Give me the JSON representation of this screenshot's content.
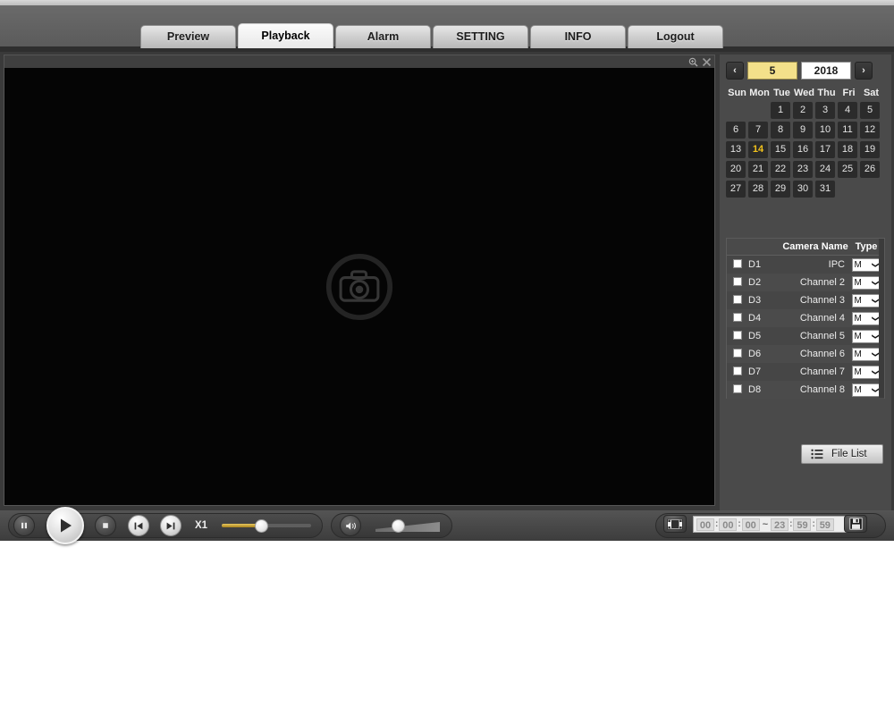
{
  "nav": {
    "tabs": [
      {
        "label": "Preview",
        "active": false
      },
      {
        "label": "Playback",
        "active": true
      },
      {
        "label": "Alarm",
        "active": false
      },
      {
        "label": "SETTING",
        "active": false
      },
      {
        "label": "INFO",
        "active": false
      },
      {
        "label": "Logout",
        "active": false
      }
    ]
  },
  "video": {
    "zoom_icon": "zoom-in-icon",
    "close_icon": "close-icon",
    "placeholder_icon": "camera-icon",
    "background_color": "#050505"
  },
  "calendar": {
    "prev_label": "‹",
    "next_label": "›",
    "month": "5",
    "year": "2018",
    "month_bg": "#f3e08a",
    "selected_day": "14",
    "selected_color": "#f2c21c",
    "weekdays": [
      "Sun",
      "Mon",
      "Tue",
      "Wed",
      "Thu",
      "Fri",
      "Sat"
    ],
    "weeks": [
      [
        "",
        "",
        "1",
        "2",
        "3",
        "4",
        "5"
      ],
      [
        "6",
        "7",
        "8",
        "9",
        "10",
        "11",
        "12"
      ],
      [
        "13",
        "14",
        "15",
        "16",
        "17",
        "18",
        "19"
      ],
      [
        "20",
        "21",
        "22",
        "23",
        "24",
        "25",
        "26"
      ],
      [
        "27",
        "28",
        "29",
        "30",
        "31",
        "",
        ""
      ]
    ]
  },
  "cameras": {
    "headers": {
      "checkbox": "",
      "id": "",
      "name": "Camera Name",
      "type": "Type"
    },
    "type_value": "M",
    "rows": [
      {
        "id": "D1",
        "name": "IPC",
        "type": "M",
        "checked": false
      },
      {
        "id": "D2",
        "name": "Channel 2",
        "type": "M",
        "checked": false
      },
      {
        "id": "D3",
        "name": "Channel 3",
        "type": "M",
        "checked": false
      },
      {
        "id": "D4",
        "name": "Channel 4",
        "type": "M",
        "checked": false
      },
      {
        "id": "D5",
        "name": "Channel 5",
        "type": "M",
        "checked": false
      },
      {
        "id": "D6",
        "name": "Channel 6",
        "type": "M",
        "checked": false
      },
      {
        "id": "D7",
        "name": "Channel 7",
        "type": "M",
        "checked": false
      },
      {
        "id": "D8",
        "name": "Channel 8",
        "type": "M",
        "checked": false
      }
    ]
  },
  "file_list": {
    "label": "File List",
    "icon": "list-icon"
  },
  "transport": {
    "pause_icon": "pause-icon",
    "play_icon": "play-icon",
    "stop_icon": "stop-icon",
    "prev_frame_icon": "previous-frame-icon",
    "next_frame_icon": "next-frame-icon",
    "speed_label": "X1",
    "speed_fill_color": "#c8a32e",
    "speed_percent": 52
  },
  "volume": {
    "icon": "volume-icon",
    "level_percent": 42
  },
  "time_range": {
    "clip_icon": "video-clip-icon",
    "save_icon": "save-icon",
    "start": {
      "hour": "00",
      "minute": "00",
      "second": "00"
    },
    "end": {
      "hour": "23",
      "minute": "59",
      "second": "59"
    },
    "separator": ":",
    "range_symbol": "~"
  }
}
